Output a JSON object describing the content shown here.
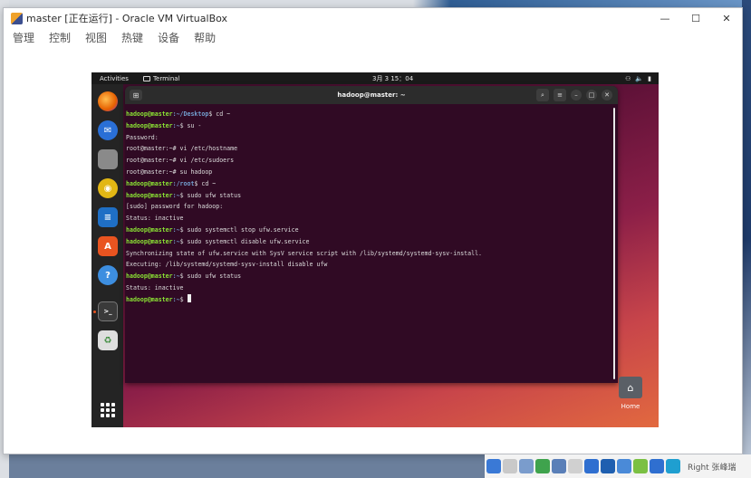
{
  "vbox": {
    "title": "master [正在运行] - Oracle VM VirtualBox",
    "controls": {
      "minimize": "—",
      "maximize": "☐",
      "close": "✕"
    },
    "menu": [
      "管理",
      "控制",
      "视图",
      "热键",
      "设备",
      "帮助"
    ]
  },
  "guest": {
    "topbar": {
      "activities": "Activities",
      "app": "Terminal",
      "clock": "3月 3  15：04",
      "tray": [
        "⚇",
        "🔈",
        "▮"
      ]
    },
    "dock": {
      "items": [
        {
          "name": "firefox-icon",
          "glyph": "",
          "color": "#e66000"
        },
        {
          "name": "thunderbird-icon",
          "glyph": "✉",
          "color": "#2a6fd6"
        },
        {
          "name": "files-icon",
          "glyph": "",
          "color": "#8a8a8a"
        },
        {
          "name": "rhythmbox-icon",
          "glyph": "◉",
          "color": "#e2b714"
        },
        {
          "name": "writer-icon",
          "glyph": "≡",
          "color": "#1f6fc5"
        },
        {
          "name": "software-icon",
          "glyph": "A",
          "color": "#e95420"
        },
        {
          "name": "help-icon",
          "glyph": "?",
          "color": "#3d8ee0"
        },
        {
          "name": "terminal-dock-icon",
          "glyph": ">_",
          "color": "#3a3a3a"
        },
        {
          "name": "trash-icon",
          "glyph": "♻",
          "color": "#dedede"
        }
      ]
    },
    "home_label": "Home",
    "terminal": {
      "title": "hadoop@master: ~",
      "lines": [
        {
          "user": "hadoop@master",
          "path": ":~/Desktop",
          "cmd": "$ cd ~"
        },
        {
          "user": "hadoop@master",
          "path": ":~",
          "cmd": "$ su -"
        },
        {
          "text": "Password:"
        },
        {
          "text": "root@master:~# vi /etc/hostname"
        },
        {
          "text": "root@master:~# vi /etc/sudoers"
        },
        {
          "text": "root@master:~# su hadoop"
        },
        {
          "user": "hadoop@master",
          "path": ":/root",
          "cmd": "$ cd ~"
        },
        {
          "user": "hadoop@master",
          "path": ":~",
          "cmd": "$ sudo ufw status"
        },
        {
          "text": "[sudo] password for hadoop:"
        },
        {
          "text": "Status: inactive"
        },
        {
          "user": "hadoop@master",
          "path": ":~",
          "cmd": "$ sudo systemctl stop ufw.service"
        },
        {
          "user": "hadoop@master",
          "path": ":~",
          "cmd": "$ sudo systemctl disable ufw.service"
        },
        {
          "text": "Synchronizing state of ufw.service with SysV service script with /lib/systemd/systemd-sysv-install."
        },
        {
          "text": "Executing: /lib/systemd/systemd-sysv-install disable ufw"
        },
        {
          "user": "hadoop@master",
          "path": ":~",
          "cmd": "$ sudo ufw status"
        },
        {
          "text": "Status: inactive"
        },
        {
          "user": "hadoop@master",
          "path": ":~",
          "cmd": "$ ",
          "cursor": true
        }
      ]
    }
  },
  "taskbar": {
    "text": "Right 张峰瑞",
    "icons": [
      {
        "name": "taskbar-icon-1",
        "color": "#3a79d6"
      },
      {
        "name": "taskbar-icon-2",
        "color": "#c9c9c9"
      },
      {
        "name": "taskbar-icon-3",
        "color": "#7a9ccc"
      },
      {
        "name": "taskbar-icon-4",
        "color": "#3fa34d"
      },
      {
        "name": "taskbar-icon-5",
        "color": "#5a7fb8"
      },
      {
        "name": "taskbar-icon-6",
        "color": "#d0d0d0"
      },
      {
        "name": "taskbar-icon-7",
        "color": "#2f6fd0"
      },
      {
        "name": "taskbar-icon-8",
        "color": "#1f5fb0"
      },
      {
        "name": "taskbar-icon-9",
        "color": "#4a8ad8"
      },
      {
        "name": "taskbar-icon-10",
        "color": "#7bc043"
      },
      {
        "name": "taskbar-icon-11",
        "color": "#2f6fd0"
      },
      {
        "name": "taskbar-icon-12",
        "color": "#1f9fd0"
      }
    ]
  }
}
